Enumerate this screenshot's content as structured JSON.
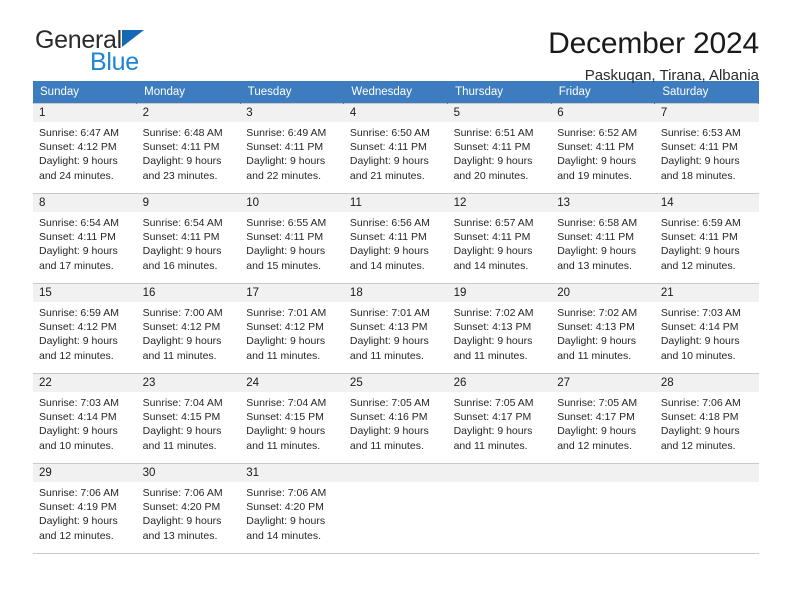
{
  "brand": {
    "name_top": "General",
    "name_bottom": "Blue",
    "mark": "triangle-logo",
    "accent_color": "#1d84d4"
  },
  "header": {
    "title": "December 2024",
    "subtitle": "Paskuqan, Tirana, Albania"
  },
  "calendar": {
    "header_bg": "#3d7dbf",
    "header_text_color": "#ffffff",
    "daynum_band_bg": "#f1f1f1",
    "weekday_headers": [
      "Sunday",
      "Monday",
      "Tuesday",
      "Wednesday",
      "Thursday",
      "Friday",
      "Saturday"
    ],
    "weeks": [
      [
        {
          "day": "1",
          "sunrise": "Sunrise: 6:47 AM",
          "sunset": "Sunset: 4:12 PM",
          "daylight_line1": "Daylight: 9 hours",
          "daylight_line2": "and 24 minutes."
        },
        {
          "day": "2",
          "sunrise": "Sunrise: 6:48 AM",
          "sunset": "Sunset: 4:11 PM",
          "daylight_line1": "Daylight: 9 hours",
          "daylight_line2": "and 23 minutes."
        },
        {
          "day": "3",
          "sunrise": "Sunrise: 6:49 AM",
          "sunset": "Sunset: 4:11 PM",
          "daylight_line1": "Daylight: 9 hours",
          "daylight_line2": "and 22 minutes."
        },
        {
          "day": "4",
          "sunrise": "Sunrise: 6:50 AM",
          "sunset": "Sunset: 4:11 PM",
          "daylight_line1": "Daylight: 9 hours",
          "daylight_line2": "and 21 minutes."
        },
        {
          "day": "5",
          "sunrise": "Sunrise: 6:51 AM",
          "sunset": "Sunset: 4:11 PM",
          "daylight_line1": "Daylight: 9 hours",
          "daylight_line2": "and 20 minutes."
        },
        {
          "day": "6",
          "sunrise": "Sunrise: 6:52 AM",
          "sunset": "Sunset: 4:11 PM",
          "daylight_line1": "Daylight: 9 hours",
          "daylight_line2": "and 19 minutes."
        },
        {
          "day": "7",
          "sunrise": "Sunrise: 6:53 AM",
          "sunset": "Sunset: 4:11 PM",
          "daylight_line1": "Daylight: 9 hours",
          "daylight_line2": "and 18 minutes."
        }
      ],
      [
        {
          "day": "8",
          "sunrise": "Sunrise: 6:54 AM",
          "sunset": "Sunset: 4:11 PM",
          "daylight_line1": "Daylight: 9 hours",
          "daylight_line2": "and 17 minutes."
        },
        {
          "day": "9",
          "sunrise": "Sunrise: 6:54 AM",
          "sunset": "Sunset: 4:11 PM",
          "daylight_line1": "Daylight: 9 hours",
          "daylight_line2": "and 16 minutes."
        },
        {
          "day": "10",
          "sunrise": "Sunrise: 6:55 AM",
          "sunset": "Sunset: 4:11 PM",
          "daylight_line1": "Daylight: 9 hours",
          "daylight_line2": "and 15 minutes."
        },
        {
          "day": "11",
          "sunrise": "Sunrise: 6:56 AM",
          "sunset": "Sunset: 4:11 PM",
          "daylight_line1": "Daylight: 9 hours",
          "daylight_line2": "and 14 minutes."
        },
        {
          "day": "12",
          "sunrise": "Sunrise: 6:57 AM",
          "sunset": "Sunset: 4:11 PM",
          "daylight_line1": "Daylight: 9 hours",
          "daylight_line2": "and 14 minutes."
        },
        {
          "day": "13",
          "sunrise": "Sunrise: 6:58 AM",
          "sunset": "Sunset: 4:11 PM",
          "daylight_line1": "Daylight: 9 hours",
          "daylight_line2": "and 13 minutes."
        },
        {
          "day": "14",
          "sunrise": "Sunrise: 6:59 AM",
          "sunset": "Sunset: 4:11 PM",
          "daylight_line1": "Daylight: 9 hours",
          "daylight_line2": "and 12 minutes."
        }
      ],
      [
        {
          "day": "15",
          "sunrise": "Sunrise: 6:59 AM",
          "sunset": "Sunset: 4:12 PM",
          "daylight_line1": "Daylight: 9 hours",
          "daylight_line2": "and 12 minutes."
        },
        {
          "day": "16",
          "sunrise": "Sunrise: 7:00 AM",
          "sunset": "Sunset: 4:12 PM",
          "daylight_line1": "Daylight: 9 hours",
          "daylight_line2": "and 11 minutes."
        },
        {
          "day": "17",
          "sunrise": "Sunrise: 7:01 AM",
          "sunset": "Sunset: 4:12 PM",
          "daylight_line1": "Daylight: 9 hours",
          "daylight_line2": "and 11 minutes."
        },
        {
          "day": "18",
          "sunrise": "Sunrise: 7:01 AM",
          "sunset": "Sunset: 4:13 PM",
          "daylight_line1": "Daylight: 9 hours",
          "daylight_line2": "and 11 minutes."
        },
        {
          "day": "19",
          "sunrise": "Sunrise: 7:02 AM",
          "sunset": "Sunset: 4:13 PM",
          "daylight_line1": "Daylight: 9 hours",
          "daylight_line2": "and 11 minutes."
        },
        {
          "day": "20",
          "sunrise": "Sunrise: 7:02 AM",
          "sunset": "Sunset: 4:13 PM",
          "daylight_line1": "Daylight: 9 hours",
          "daylight_line2": "and 11 minutes."
        },
        {
          "day": "21",
          "sunrise": "Sunrise: 7:03 AM",
          "sunset": "Sunset: 4:14 PM",
          "daylight_line1": "Daylight: 9 hours",
          "daylight_line2": "and 10 minutes."
        }
      ],
      [
        {
          "day": "22",
          "sunrise": "Sunrise: 7:03 AM",
          "sunset": "Sunset: 4:14 PM",
          "daylight_line1": "Daylight: 9 hours",
          "daylight_line2": "and 10 minutes."
        },
        {
          "day": "23",
          "sunrise": "Sunrise: 7:04 AM",
          "sunset": "Sunset: 4:15 PM",
          "daylight_line1": "Daylight: 9 hours",
          "daylight_line2": "and 11 minutes."
        },
        {
          "day": "24",
          "sunrise": "Sunrise: 7:04 AM",
          "sunset": "Sunset: 4:15 PM",
          "daylight_line1": "Daylight: 9 hours",
          "daylight_line2": "and 11 minutes."
        },
        {
          "day": "25",
          "sunrise": "Sunrise: 7:05 AM",
          "sunset": "Sunset: 4:16 PM",
          "daylight_line1": "Daylight: 9 hours",
          "daylight_line2": "and 11 minutes."
        },
        {
          "day": "26",
          "sunrise": "Sunrise: 7:05 AM",
          "sunset": "Sunset: 4:17 PM",
          "daylight_line1": "Daylight: 9 hours",
          "daylight_line2": "and 11 minutes."
        },
        {
          "day": "27",
          "sunrise": "Sunrise: 7:05 AM",
          "sunset": "Sunset: 4:17 PM",
          "daylight_line1": "Daylight: 9 hours",
          "daylight_line2": "and 12 minutes."
        },
        {
          "day": "28",
          "sunrise": "Sunrise: 7:06 AM",
          "sunset": "Sunset: 4:18 PM",
          "daylight_line1": "Daylight: 9 hours",
          "daylight_line2": "and 12 minutes."
        }
      ],
      [
        {
          "day": "29",
          "sunrise": "Sunrise: 7:06 AM",
          "sunset": "Sunset: 4:19 PM",
          "daylight_line1": "Daylight: 9 hours",
          "daylight_line2": "and 12 minutes."
        },
        {
          "day": "30",
          "sunrise": "Sunrise: 7:06 AM",
          "sunset": "Sunset: 4:20 PM",
          "daylight_line1": "Daylight: 9 hours",
          "daylight_line2": "and 13 minutes."
        },
        {
          "day": "31",
          "sunrise": "Sunrise: 7:06 AM",
          "sunset": "Sunset: 4:20 PM",
          "daylight_line1": "Daylight: 9 hours",
          "daylight_line2": "and 14 minutes."
        },
        {
          "day": "",
          "sunrise": "",
          "sunset": "",
          "daylight_line1": "",
          "daylight_line2": ""
        },
        {
          "day": "",
          "sunrise": "",
          "sunset": "",
          "daylight_line1": "",
          "daylight_line2": ""
        },
        {
          "day": "",
          "sunrise": "",
          "sunset": "",
          "daylight_line1": "",
          "daylight_line2": ""
        },
        {
          "day": "",
          "sunrise": "",
          "sunset": "",
          "daylight_line1": "",
          "daylight_line2": ""
        }
      ]
    ]
  }
}
